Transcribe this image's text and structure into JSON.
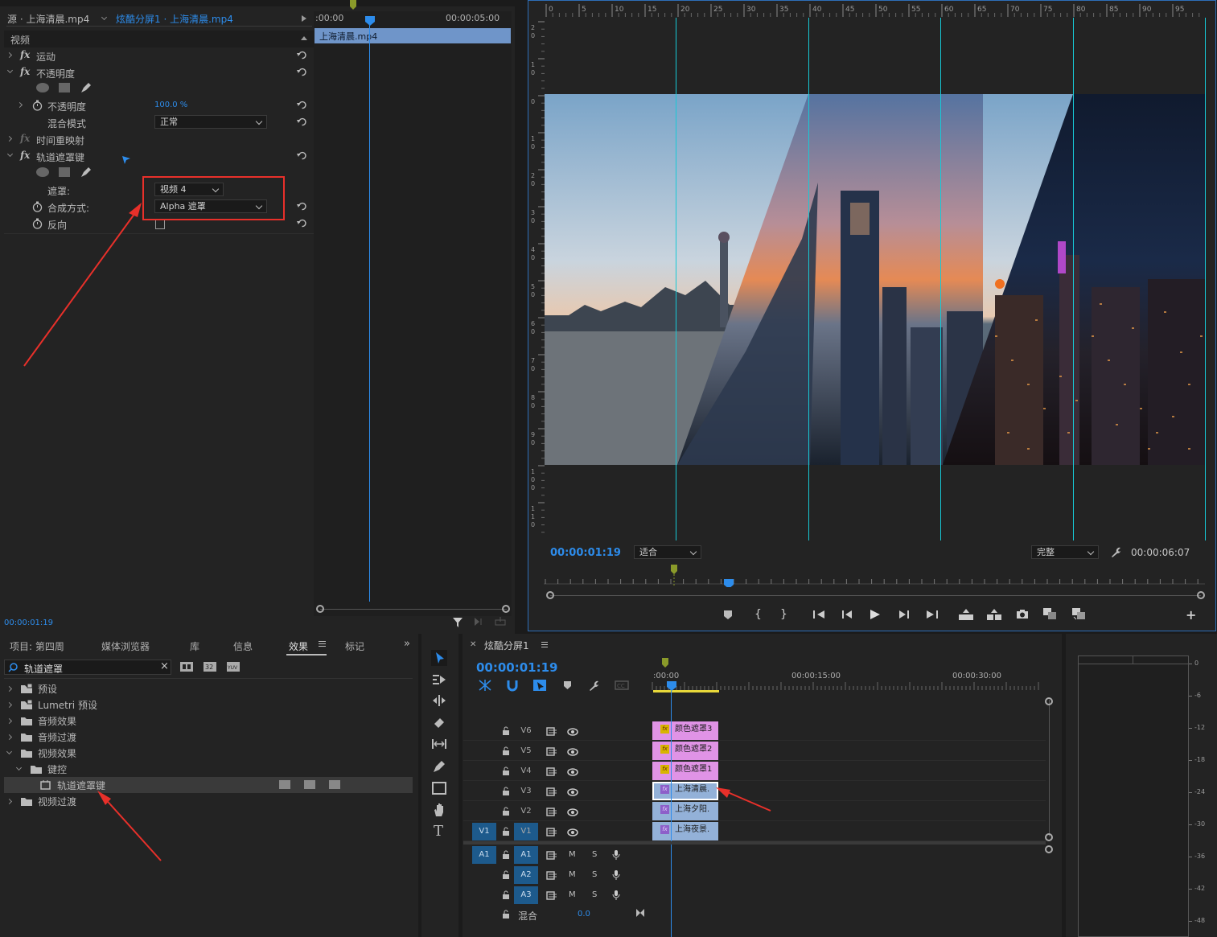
{
  "effect_controls": {
    "source_tab": "源 · 上海清晨.mp4",
    "sequence_tab": "炫酷分屏1 · 上海清晨.mp4",
    "section_video": "视频",
    "motion": "运动",
    "opacity": "不透明度",
    "opacity_param": "不透明度",
    "opacity_value": "100.0 %",
    "blend_mode_label": "混合模式",
    "blend_mode_value": "正常",
    "time_remap": "时间重映射",
    "track_matte": "轨道遮罩键",
    "matte_label": "遮罩:",
    "matte_value": "视频 4",
    "composite_label": "合成方式:",
    "composite_value": "Alpha 遮罩",
    "reverse_label": "反向",
    "timecode": "00:00:01:19",
    "mini_ruler_start": ":00:00",
    "mini_ruler_end": "00:00:05:00",
    "mini_clip": "上海清晨.mp4"
  },
  "program_monitor": {
    "timecode": "00:00:01:19",
    "fit_value": "适合",
    "quality_value": "完整",
    "duration": "00:00:06:07",
    "ruler_top": [
      "0",
      "5",
      "10",
      "15",
      "20",
      "25",
      "30",
      "35",
      "40",
      "45",
      "50",
      "55",
      "60",
      "65",
      "70",
      "75",
      "80",
      "85",
      "90",
      "95"
    ],
    "ruler_left": [
      "2 0",
      "1 0",
      "0",
      "1 0",
      "2 0",
      "3 0",
      "4 0",
      "5 0",
      "6 0",
      "7 0",
      "8 0",
      "9 0",
      "1 0 0",
      "1 1 0"
    ]
  },
  "project_panel": {
    "tabs": [
      "项目: 第四周",
      "媒体浏览器",
      "库",
      "信息",
      "效果",
      "标记"
    ],
    "search_value": "轨道遮罩",
    "tree": [
      {
        "label": "预设",
        "indent": 0,
        "open": false,
        "icon": "preset-folder-icon"
      },
      {
        "label": "Lumetri 预设",
        "indent": 0,
        "open": false,
        "icon": "preset-folder-icon"
      },
      {
        "label": "音频效果",
        "indent": 0,
        "open": false,
        "icon": "folder-icon"
      },
      {
        "label": "音频过渡",
        "indent": 0,
        "open": false,
        "icon": "folder-icon"
      },
      {
        "label": "视频效果",
        "indent": 0,
        "open": true,
        "icon": "folder-icon"
      },
      {
        "label": "键控",
        "indent": 1,
        "open": true,
        "icon": "folder-icon"
      },
      {
        "label": "轨道遮罩键",
        "indent": 2,
        "open": false,
        "icon": "effect-icon",
        "selected": true
      },
      {
        "label": "视频过渡",
        "indent": 0,
        "open": false,
        "icon": "folder-icon"
      }
    ]
  },
  "timeline": {
    "title": "炫酷分屏1",
    "timecode": "00:00:01:19",
    "ruler": [
      ":00:00",
      "00:00:15:00",
      "00:00:30:00"
    ],
    "video_tracks": [
      {
        "name": "V6",
        "clip": "颜色遮罩3",
        "type": "matte"
      },
      {
        "name": "V5",
        "clip": "颜色遮罩2",
        "type": "matte"
      },
      {
        "name": "V4",
        "clip": "颜色遮罩1",
        "type": "matte"
      },
      {
        "name": "V3",
        "clip": "上海清晨.",
        "type": "video",
        "selected": true
      },
      {
        "name": "V2",
        "clip": "上海夕阳.",
        "type": "video"
      },
      {
        "name": "V1",
        "clip": "上海夜景.",
        "type": "video",
        "source": "V1"
      }
    ],
    "audio_tracks": [
      {
        "name": "A1",
        "source": "A1"
      },
      {
        "name": "A2"
      },
      {
        "name": "A3"
      }
    ],
    "mute_label": "M",
    "solo_label": "S",
    "mix_label": "混合",
    "mix_value": "0.0"
  },
  "audio_meter": {
    "ticks": [
      "0",
      "-6",
      "-12",
      "-18",
      "-24",
      "-30",
      "-36",
      "-42",
      "-48"
    ]
  },
  "colors": {
    "accent": "#2d8ceb",
    "guide": "#17c9d6",
    "arrow": "#e8302a",
    "matte_clip": "#e093e6",
    "video_clip": "#93b1d8"
  }
}
